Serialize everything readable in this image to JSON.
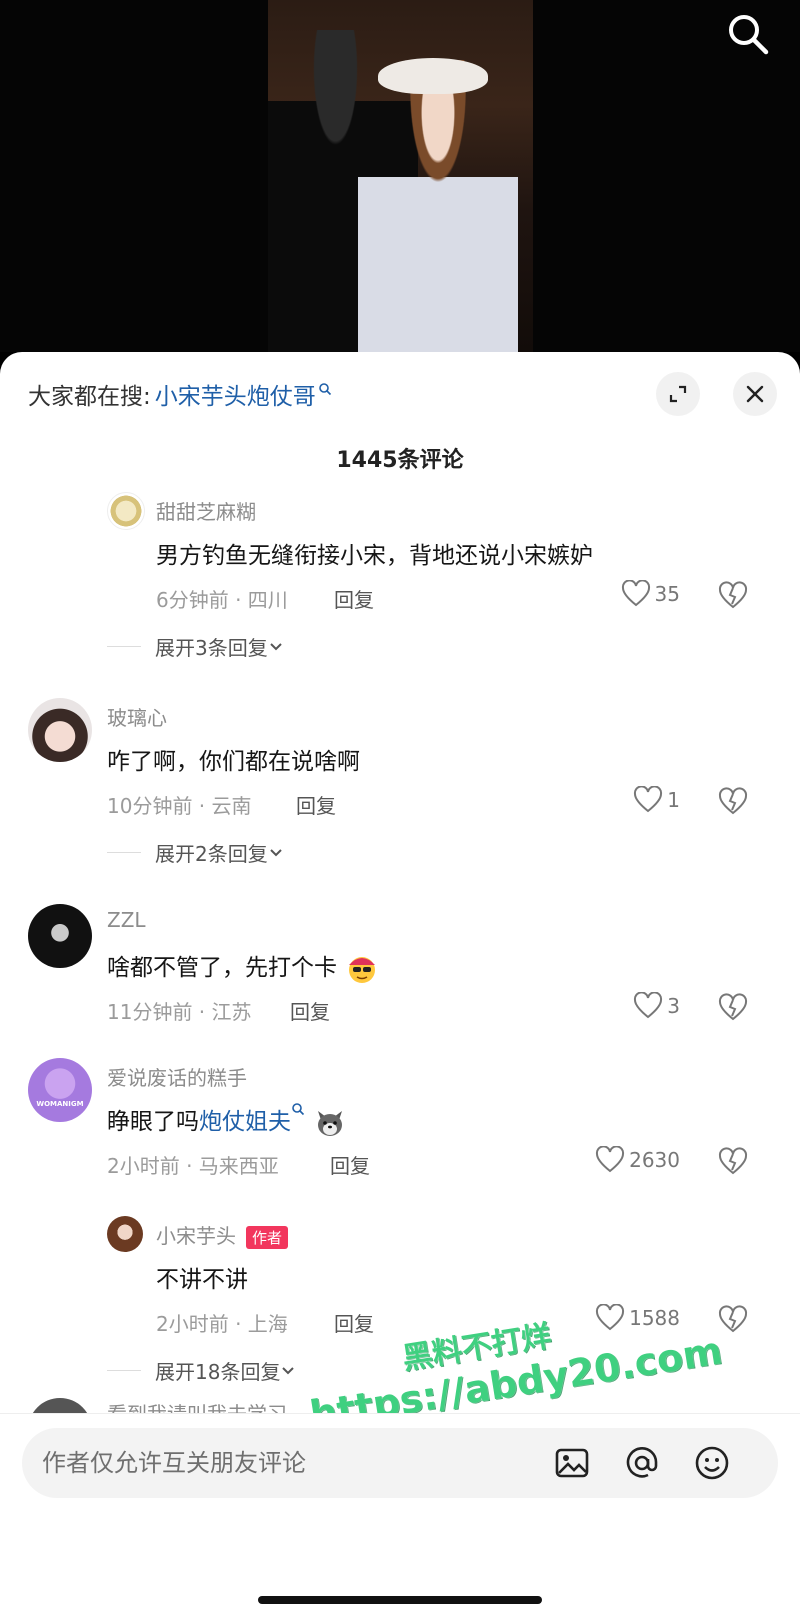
{
  "trending": {
    "prefix": "大家都在搜:",
    "keyword": "小宋芋头炮仗哥"
  },
  "comment_count": "1445条评论",
  "comments": [
    {
      "username": "甜甜芝麻糊",
      "text": "男方钓鱼无缝衔接小宋，背地还说小宋嫉妒",
      "meta": "6分钟前 · 四川",
      "reply": "回复",
      "likes": "35",
      "expand": "展开3条回复"
    },
    {
      "username": "玻璃心",
      "text": "咋了啊，你们都在说啥啊",
      "meta": "10分钟前 · 云南",
      "reply": "回复",
      "likes": "1",
      "expand": "展开2条回复"
    },
    {
      "username": "ZZL",
      "text": "啥都不管了，先打个卡",
      "meta": "11分钟前 · 江苏",
      "reply": "回复",
      "likes": "3"
    },
    {
      "username": "爱说废话的糕手",
      "text": "睁眼了吗",
      "link": "炮仗姐夫",
      "meta": "2小时前 · 马来西亚",
      "reply": "回复",
      "likes": "2630",
      "avatar_text": "WOMANIGM"
    }
  ],
  "author_reply": {
    "username": "小宋芋头",
    "badge": "作者",
    "text": "不讲不讲",
    "meta": "2小时前 · 上海",
    "reply": "回复",
    "likes": "1588",
    "expand": "展开18条回复"
  },
  "partial_next": "看到我请叫我去学习",
  "input": {
    "placeholder": "作者仅允许互关朋友评论"
  },
  "watermark": {
    "line1": "黑料不打烊",
    "line2": "https://abdy20.com"
  },
  "colors": {
    "link": "#1f5fa8",
    "badge": "#f2365d",
    "watermark": "#3fd080"
  },
  "icons": [
    "search-icon",
    "magnifier-small-icon",
    "expand-icon",
    "close-icon",
    "heart-icon",
    "broken-heart-icon",
    "chevron-down-icon",
    "image-icon",
    "at-icon",
    "emoji-icon"
  ]
}
